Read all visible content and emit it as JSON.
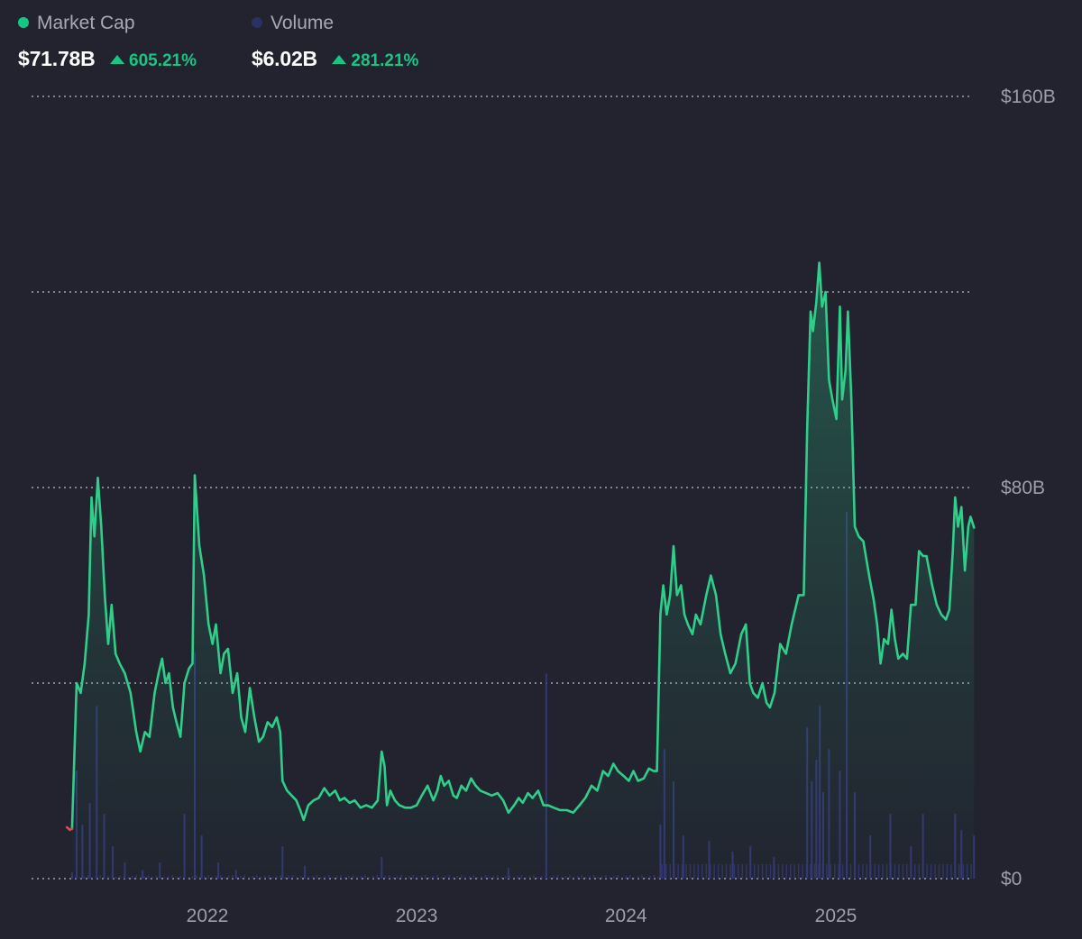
{
  "header": {
    "market_cap": {
      "label": "Market Cap",
      "value": "$71.78B",
      "change": "605.21%",
      "color": "#16c784"
    },
    "volume": {
      "label": "Volume",
      "value": "$6.02B",
      "change": "281.21%",
      "color": "#2b3163"
    }
  },
  "colors": {
    "background": "#22232f",
    "line": "#2ecf8a",
    "volume_bar": "#343a78",
    "grid": "#d8d9e0",
    "down": "#e5484d",
    "positive": "#16c784"
  },
  "chart_data": {
    "type": "area",
    "title": "",
    "xlabel": "",
    "ylabel": "",
    "x_ticks": [
      "2022",
      "2023",
      "2024",
      "2025"
    ],
    "y_ticks": [
      "$0",
      "$80B",
      "$160B"
    ],
    "ylim": [
      0,
      160
    ],
    "grid": true,
    "series": [
      {
        "name": "Market Cap",
        "unit": "B USD",
        "points": [
          [
            "2021-05-01",
            10.5
          ],
          [
            "2021-05-06",
            10.0
          ],
          [
            "2021-05-10",
            10.2
          ],
          [
            "2021-05-18",
            40.0
          ],
          [
            "2021-05-25",
            38.0
          ],
          [
            "2021-06-01",
            44.0
          ],
          [
            "2021-06-08",
            54.0
          ],
          [
            "2021-06-13",
            78.0
          ],
          [
            "2021-06-18",
            70.0
          ],
          [
            "2021-06-24",
            82.0
          ],
          [
            "2021-06-30",
            72.0
          ],
          [
            "2021-07-06",
            58.0
          ],
          [
            "2021-07-12",
            48.0
          ],
          [
            "2021-07-18",
            56.0
          ],
          [
            "2021-07-25",
            46.0
          ],
          [
            "2021-08-01",
            44.0
          ],
          [
            "2021-08-10",
            42.0
          ],
          [
            "2021-08-20",
            38.0
          ],
          [
            "2021-08-30",
            30.0
          ],
          [
            "2021-09-06",
            26.0
          ],
          [
            "2021-09-14",
            30.0
          ],
          [
            "2021-09-22",
            29.0
          ],
          [
            "2021-10-01",
            38.0
          ],
          [
            "2021-10-08",
            42.0
          ],
          [
            "2021-10-14",
            45.0
          ],
          [
            "2021-10-20",
            40.0
          ],
          [
            "2021-10-26",
            42.0
          ],
          [
            "2021-11-02",
            35.0
          ],
          [
            "2021-11-08",
            32.0
          ],
          [
            "2021-11-15",
            29.0
          ],
          [
            "2021-11-22",
            40.0
          ],
          [
            "2021-11-30",
            43.0
          ],
          [
            "2021-12-06",
            44.0
          ],
          [
            "2021-12-10",
            82.5
          ],
          [
            "2021-12-18",
            68.0
          ],
          [
            "2021-12-26",
            62.0
          ],
          [
            "2022-01-03",
            52.0
          ],
          [
            "2022-01-10",
            48.0
          ],
          [
            "2022-01-16",
            52.0
          ],
          [
            "2022-01-24",
            42.0
          ],
          [
            "2022-01-30",
            46.0
          ],
          [
            "2022-02-06",
            47.0
          ],
          [
            "2022-02-14",
            38.0
          ],
          [
            "2022-02-22",
            42.0
          ],
          [
            "2022-03-01",
            33.0
          ],
          [
            "2022-03-08",
            30.0
          ],
          [
            "2022-03-16",
            39.0
          ],
          [
            "2022-03-24",
            33.0
          ],
          [
            "2022-04-01",
            28.0
          ],
          [
            "2022-04-08",
            29.0
          ],
          [
            "2022-04-16",
            32.0
          ],
          [
            "2022-04-24",
            31.0
          ],
          [
            "2022-05-02",
            33.0
          ],
          [
            "2022-05-08",
            30.0
          ],
          [
            "2022-05-12",
            20.0
          ],
          [
            "2022-05-20",
            18.0
          ],
          [
            "2022-05-28",
            17.0
          ],
          [
            "2022-06-05",
            16.0
          ],
          [
            "2022-06-12",
            14.0
          ],
          [
            "2022-06-18",
            12.0
          ],
          [
            "2022-06-26",
            15.0
          ],
          [
            "2022-07-05",
            16.0
          ],
          [
            "2022-07-14",
            16.5
          ],
          [
            "2022-07-24",
            18.5
          ],
          [
            "2022-08-02",
            17.0
          ],
          [
            "2022-08-12",
            18.0
          ],
          [
            "2022-08-20",
            16.0
          ],
          [
            "2022-08-28",
            16.5
          ],
          [
            "2022-09-06",
            15.5
          ],
          [
            "2022-09-15",
            16.0
          ],
          [
            "2022-09-25",
            14.5
          ],
          [
            "2022-10-05",
            15.0
          ],
          [
            "2022-10-15",
            14.5
          ],
          [
            "2022-10-25",
            16.0
          ],
          [
            "2022-11-01",
            26.0
          ],
          [
            "2022-11-06",
            23.0
          ],
          [
            "2022-11-10",
            15.0
          ],
          [
            "2022-11-16",
            18.0
          ],
          [
            "2022-11-24",
            16.0
          ],
          [
            "2022-12-02",
            15.0
          ],
          [
            "2022-12-12",
            14.5
          ],
          [
            "2022-12-22",
            14.5
          ],
          [
            "2023-01-01",
            15.0
          ],
          [
            "2023-01-10",
            17.0
          ],
          [
            "2023-01-20",
            19.0
          ],
          [
            "2023-01-30",
            16.0
          ],
          [
            "2023-02-06",
            18.0
          ],
          [
            "2023-02-12",
            21.0
          ],
          [
            "2023-02-18",
            19.0
          ],
          [
            "2023-02-26",
            20.0
          ],
          [
            "2023-03-06",
            17.0
          ],
          [
            "2023-03-12",
            16.5
          ],
          [
            "2023-03-20",
            19.0
          ],
          [
            "2023-03-28",
            18.0
          ],
          [
            "2023-04-06",
            20.5
          ],
          [
            "2023-04-14",
            19.0
          ],
          [
            "2023-04-22",
            18.0
          ],
          [
            "2023-05-02",
            17.5
          ],
          [
            "2023-05-12",
            17.0
          ],
          [
            "2023-05-22",
            17.5
          ],
          [
            "2023-06-01",
            16.0
          ],
          [
            "2023-06-10",
            13.5
          ],
          [
            "2023-06-20",
            15.0
          ],
          [
            "2023-06-28",
            16.5
          ],
          [
            "2023-07-05",
            15.5
          ],
          [
            "2023-07-14",
            17.5
          ],
          [
            "2023-07-22",
            16.5
          ],
          [
            "2023-08-01",
            18.0
          ],
          [
            "2023-08-10",
            15.0
          ],
          [
            "2023-08-18",
            15.0
          ],
          [
            "2023-08-28",
            14.5
          ],
          [
            "2023-09-08",
            14.0
          ],
          [
            "2023-09-20",
            14.0
          ],
          [
            "2023-10-01",
            13.5
          ],
          [
            "2023-10-12",
            15.0
          ],
          [
            "2023-10-22",
            16.5
          ],
          [
            "2023-11-02",
            19.0
          ],
          [
            "2023-11-12",
            18.0
          ],
          [
            "2023-11-22",
            22.0
          ],
          [
            "2023-12-01",
            21.0
          ],
          [
            "2023-12-10",
            23.5
          ],
          [
            "2023-12-18",
            22.0
          ],
          [
            "2023-12-28",
            21.0
          ],
          [
            "2024-01-06",
            20.0
          ],
          [
            "2024-01-14",
            22.0
          ],
          [
            "2024-01-22",
            20.0
          ],
          [
            "2024-02-01",
            20.5
          ],
          [
            "2024-02-10",
            22.5
          ],
          [
            "2024-02-18",
            22.0
          ],
          [
            "2024-02-24",
            22.0
          ],
          [
            "2024-03-01",
            54.0
          ],
          [
            "2024-03-06",
            60.0
          ],
          [
            "2024-03-12",
            54.0
          ],
          [
            "2024-03-18",
            58.0
          ],
          [
            "2024-03-24",
            68.0
          ],
          [
            "2024-03-30",
            58.0
          ],
          [
            "2024-04-06",
            60.0
          ],
          [
            "2024-04-12",
            54.0
          ],
          [
            "2024-04-18",
            52.0
          ],
          [
            "2024-04-26",
            50.0
          ],
          [
            "2024-05-02",
            54.0
          ],
          [
            "2024-05-10",
            52.0
          ],
          [
            "2024-05-20",
            58.0
          ],
          [
            "2024-05-28",
            62.0
          ],
          [
            "2024-06-06",
            58.0
          ],
          [
            "2024-06-14",
            50.0
          ],
          [
            "2024-06-22",
            46.0
          ],
          [
            "2024-07-01",
            42.0
          ],
          [
            "2024-07-10",
            44.0
          ],
          [
            "2024-07-20",
            50.0
          ],
          [
            "2024-07-28",
            52.0
          ],
          [
            "2024-08-04",
            40.0
          ],
          [
            "2024-08-10",
            38.0
          ],
          [
            "2024-08-18",
            37.0
          ],
          [
            "2024-08-26",
            40.0
          ],
          [
            "2024-09-02",
            36.0
          ],
          [
            "2024-09-08",
            35.0
          ],
          [
            "2024-09-16",
            38.0
          ],
          [
            "2024-09-26",
            48.0
          ],
          [
            "2024-10-06",
            46.0
          ],
          [
            "2024-10-16",
            52.0
          ],
          [
            "2024-10-28",
            58.0
          ],
          [
            "2024-11-06",
            58.0
          ],
          [
            "2024-11-12",
            92.0
          ],
          [
            "2024-11-18",
            116.0
          ],
          [
            "2024-11-22",
            112.0
          ],
          [
            "2024-11-28",
            118.0
          ],
          [
            "2024-12-03",
            126.0
          ],
          [
            "2024-12-08",
            117.0
          ],
          [
            "2024-12-14",
            120.0
          ],
          [
            "2024-12-20",
            102.0
          ],
          [
            "2024-12-26",
            98.0
          ],
          [
            "2025-01-02",
            94.0
          ],
          [
            "2025-01-08",
            117.0
          ],
          [
            "2025-01-12",
            98.0
          ],
          [
            "2025-01-18",
            104.0
          ],
          [
            "2025-01-22",
            116.0
          ],
          [
            "2025-01-28",
            98.0
          ],
          [
            "2025-02-03",
            72.0
          ],
          [
            "2025-02-10",
            70.0
          ],
          [
            "2025-02-18",
            69.0
          ],
          [
            "2025-02-28",
            62.0
          ],
          [
            "2025-03-08",
            57.0
          ],
          [
            "2025-03-14",
            52.0
          ],
          [
            "2025-03-20",
            44.0
          ],
          [
            "2025-03-26",
            49.0
          ],
          [
            "2025-04-02",
            48.0
          ],
          [
            "2025-04-08",
            55.0
          ],
          [
            "2025-04-14",
            49.0
          ],
          [
            "2025-04-20",
            45.0
          ],
          [
            "2025-04-28",
            46.0
          ],
          [
            "2025-05-05",
            45.0
          ],
          [
            "2025-05-12",
            56.0
          ],
          [
            "2025-05-20",
            56.0
          ],
          [
            "2025-05-26",
            67.0
          ],
          [
            "2025-06-02",
            66.0
          ],
          [
            "2025-06-08",
            66.0
          ],
          [
            "2025-06-18",
            60.0
          ],
          [
            "2025-06-26",
            56.0
          ],
          [
            "2025-07-04",
            54.0
          ],
          [
            "2025-07-12",
            53.0
          ],
          [
            "2025-07-18",
            55.0
          ],
          [
            "2025-07-24",
            67.0
          ],
          [
            "2025-07-28",
            78.0
          ],
          [
            "2025-08-02",
            72.0
          ],
          [
            "2025-08-08",
            76.0
          ],
          [
            "2025-08-14",
            63.0
          ],
          [
            "2025-08-20",
            72.0
          ],
          [
            "2025-08-24",
            74.0
          ],
          [
            "2025-08-30",
            71.8
          ]
        ]
      },
      {
        "name": "Volume",
        "unit": "B USD",
        "points": [
          [
            "2021-05-10",
            0.6
          ],
          [
            "2021-05-18",
            10.0
          ],
          [
            "2021-05-28",
            5.0
          ],
          [
            "2021-06-10",
            7.0
          ],
          [
            "2021-06-22",
            16.0
          ],
          [
            "2021-07-05",
            6.0
          ],
          [
            "2021-07-20",
            3.0
          ],
          [
            "2021-08-10",
            1.5
          ],
          [
            "2021-09-10",
            0.8
          ],
          [
            "2021-10-10",
            1.5
          ],
          [
            "2021-11-22",
            6.0
          ],
          [
            "2021-12-10",
            21.0
          ],
          [
            "2021-12-22",
            4.0
          ],
          [
            "2022-01-20",
            1.5
          ],
          [
            "2022-02-20",
            0.8
          ],
          [
            "2022-05-12",
            3.0
          ],
          [
            "2022-06-20",
            1.2
          ],
          [
            "2022-11-01",
            2.0
          ],
          [
            "2023-06-10",
            1.0
          ],
          [
            "2023-08-15",
            19.0
          ],
          [
            "2024-03-01",
            5.0
          ],
          [
            "2024-03-08",
            12.0
          ],
          [
            "2024-03-24",
            9.0
          ],
          [
            "2024-04-10",
            4.0
          ],
          [
            "2024-05-25",
            3.5
          ],
          [
            "2024-07-05",
            2.5
          ],
          [
            "2024-08-05",
            3.0
          ],
          [
            "2024-09-15",
            2.0
          ],
          [
            "2024-11-12",
            14.0
          ],
          [
            "2024-11-20",
            9.0
          ],
          [
            "2024-11-28",
            11.0
          ],
          [
            "2024-12-04",
            16.0
          ],
          [
            "2024-12-10",
            8.0
          ],
          [
            "2024-12-20",
            12.0
          ],
          [
            "2025-01-08",
            10.0
          ],
          [
            "2025-01-20",
            34.0
          ],
          [
            "2025-02-03",
            8.0
          ],
          [
            "2025-03-02",
            4.0
          ],
          [
            "2025-04-06",
            6.0
          ],
          [
            "2025-05-12",
            3.0
          ],
          [
            "2025-06-02",
            6.0
          ],
          [
            "2025-07-28",
            6.0
          ],
          [
            "2025-08-08",
            4.5
          ],
          [
            "2025-08-30",
            4.0
          ]
        ]
      }
    ]
  }
}
